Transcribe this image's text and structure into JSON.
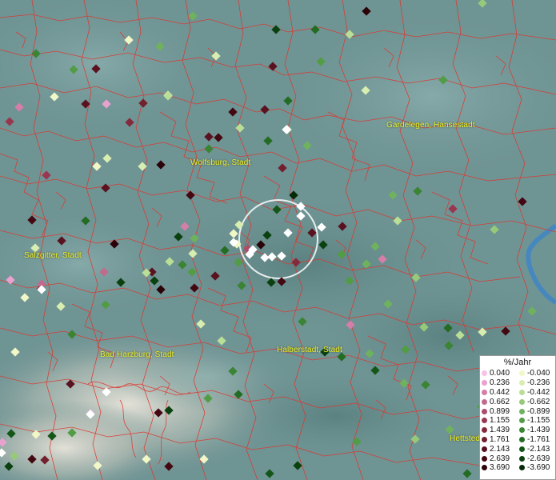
{
  "places": [
    {
      "id": "gardelegen",
      "name": "Gardelegen, Hansestadt"
    },
    {
      "id": "wolfsburg",
      "name": "Wolfsburg, Stadt"
    },
    {
      "id": "salzgitter",
      "name": "Salzgitter, Stadt"
    },
    {
      "id": "bad-harzburg",
      "name": "Bad Harzburg, Stadt"
    },
    {
      "id": "halberstadt",
      "name": "Halberstadt, Stadt"
    },
    {
      "id": "hettstedt",
      "name": "Hettstedt"
    }
  ],
  "legend": {
    "title": "%/Jahr",
    "positive": [
      {
        "value": "0.040",
        "color": "#f7c2ea"
      },
      {
        "value": "0.236",
        "color": "#e9a1cf"
      },
      {
        "value": "0.442",
        "color": "#d47ea9"
      },
      {
        "value": "0.662",
        "color": "#c16a8d"
      },
      {
        "value": "0.899",
        "color": "#ab4c6b"
      },
      {
        "value": "1.155",
        "color": "#98374f"
      },
      {
        "value": "1.439",
        "color": "#852a3d"
      },
      {
        "value": "1.761",
        "color": "#71202e"
      },
      {
        "value": "2.143",
        "color": "#5a1220"
      },
      {
        "value": "2.639",
        "color": "#430812"
      },
      {
        "value": "3.690",
        "color": "#2a0208"
      }
    ],
    "negative": [
      {
        "value": "-0.040",
        "color": "#f1f7c6"
      },
      {
        "value": "-0.236",
        "color": "#d8edb0"
      },
      {
        "value": "-0.442",
        "color": "#b9de96"
      },
      {
        "value": "-0.662",
        "color": "#96c97a"
      },
      {
        "value": "-0.899",
        "color": "#6fb25d"
      },
      {
        "value": "-1.155",
        "color": "#529c45"
      },
      {
        "value": "-1.439",
        "color": "#3a8433"
      },
      {
        "value": "-1.761",
        "color": "#246c23"
      },
      {
        "value": "-2.143",
        "color": "#145618"
      },
      {
        "value": "-2.639",
        "color": "#0a410f"
      },
      {
        "value": "-3.690",
        "color": "#042a07"
      }
    ]
  },
  "colors": {
    "border": "#e0342c",
    "label": "#f2ee20",
    "highlight": "#ffffff",
    "river": "#3f86c4"
  }
}
